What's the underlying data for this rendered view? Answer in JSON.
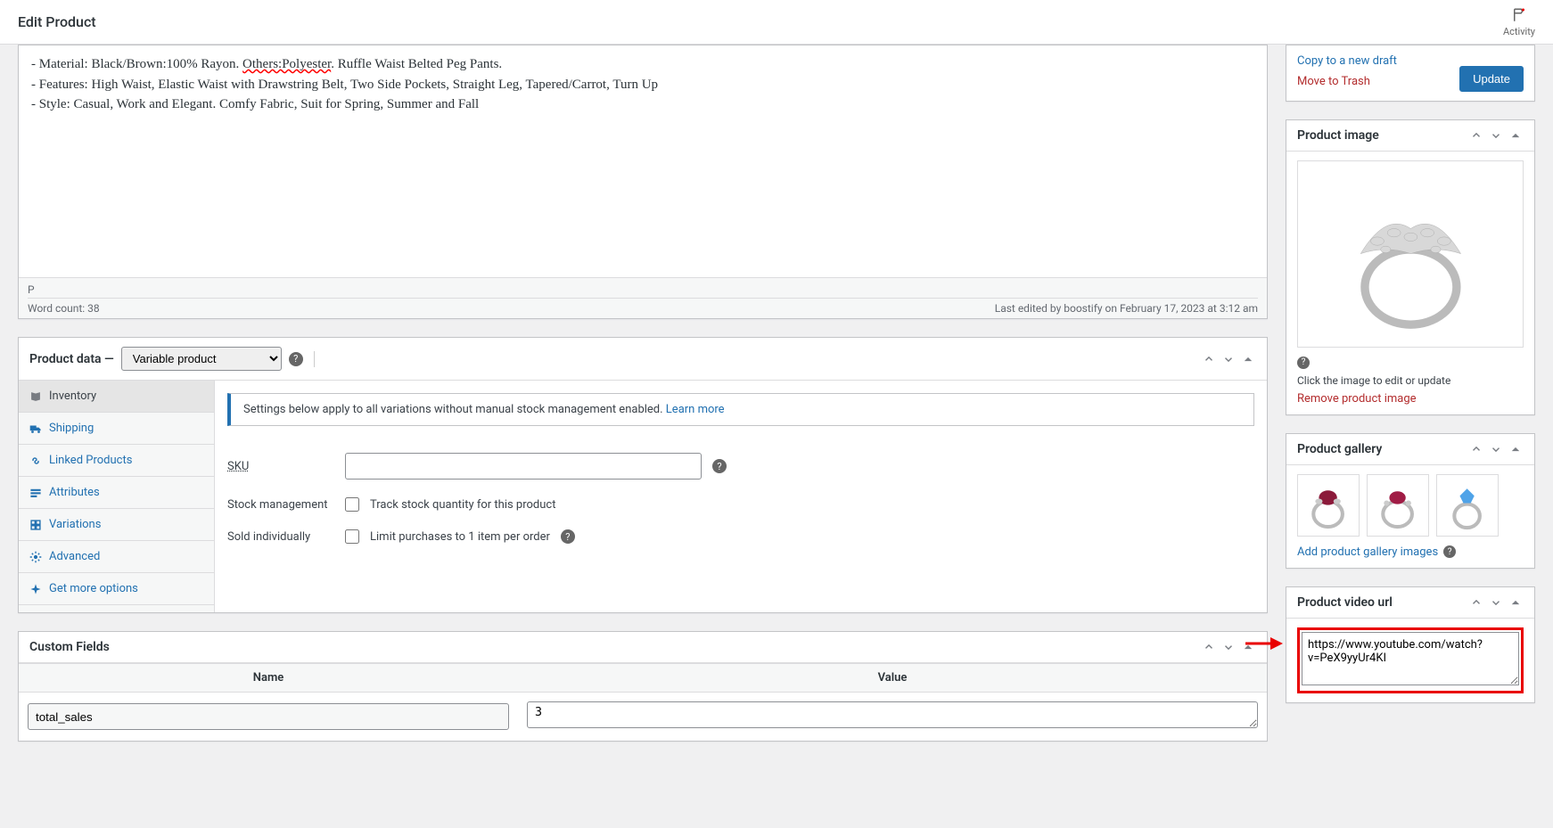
{
  "header": {
    "title": "Edit Product",
    "activity_label": "Activity"
  },
  "editor": {
    "line1_prefix": "- Material: Black/Brown:100% Rayon. ",
    "line1_err": "Others:Polyester",
    "line1_suffix": ". Ruffle Waist Belted Peg Pants.",
    "line2": "- Features: High Waist, Elastic Waist with Drawstring Belt, Two Side Pockets, Straight Leg, Tapered/Carrot, Turn Up",
    "line3": "- Style: Casual, Work and Elegant. Comfy Fabric, Suit for Spring, Summer and Fall",
    "path": "P",
    "wordcount": "Word count: 38",
    "lastedit": "Last edited by boostify on February 17, 2023 at 3:12 am"
  },
  "product_data": {
    "title": "Product data",
    "dash": "—",
    "type_label": "Variable product",
    "notice_text": "Settings below apply to all variations without manual stock management enabled. ",
    "notice_link": "Learn more",
    "tabs": {
      "inventory": "Inventory",
      "shipping": "Shipping",
      "linked": "Linked Products",
      "attributes": "Attributes",
      "variations": "Variations",
      "advanced": "Advanced",
      "more": "Get more options"
    },
    "fields": {
      "sku_label": "SKU",
      "sku_value": "",
      "stock_label": "Stock management",
      "stock_chk": "Track stock quantity for this product",
      "sold_label": "Sold individually",
      "sold_chk": "Limit purchases to 1 item per order"
    }
  },
  "custom_fields": {
    "title": "Custom Fields",
    "name_header": "Name",
    "value_header": "Value",
    "row": {
      "name": "total_sales",
      "value": "3"
    }
  },
  "sidebar": {
    "publish": {
      "copy": "Copy to a new draft",
      "trash": "Move to Trash",
      "update": "Update"
    },
    "image": {
      "title": "Product image",
      "caption": "Click the image to edit or update",
      "remove": "Remove product image"
    },
    "gallery": {
      "title": "Product gallery",
      "add": "Add product gallery images"
    },
    "video": {
      "title": "Product video url",
      "value": "https://www.youtube.com/watch?v=PeX9yyUr4KI"
    }
  }
}
